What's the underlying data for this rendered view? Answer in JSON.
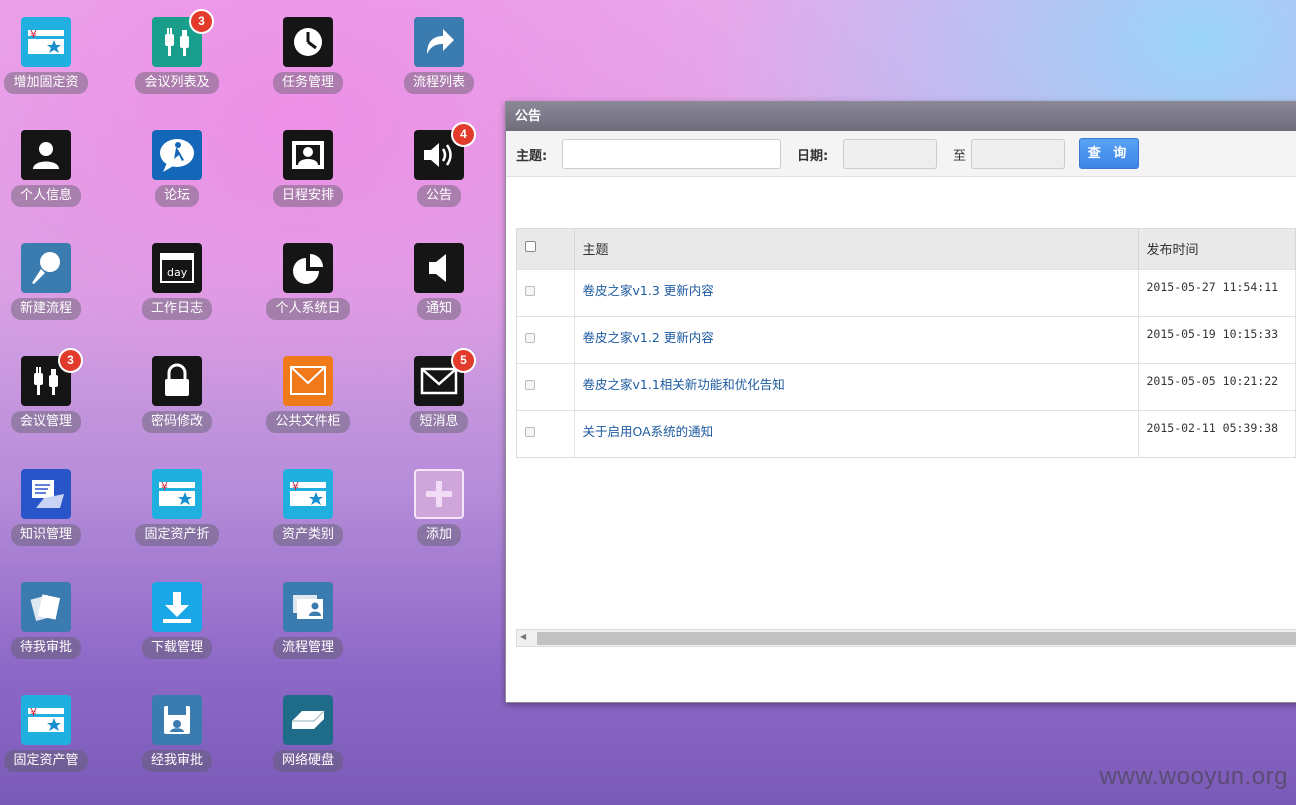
{
  "desktop": {
    "icons": [
      {
        "label": "增加固定资",
        "icon": "asset-card-icon",
        "color": "#1fb0e0"
      },
      {
        "label": "会议列表及",
        "icon": "plug-icon",
        "color": "#1a9e8c",
        "badge": "3"
      },
      {
        "label": "任务管理",
        "icon": "clock-icon",
        "color": "#151515"
      },
      {
        "label": "流程列表",
        "icon": "share-arrow-icon",
        "color": "#3a7bb0"
      },
      {
        "label": "个人信息",
        "icon": "person-icon",
        "color": "#151515"
      },
      {
        "label": "论坛",
        "icon": "forum-bubble-icon",
        "color": "#1466b8"
      },
      {
        "label": "日程安排",
        "icon": "schedule-icon",
        "color": "#151515"
      },
      {
        "label": "公告",
        "icon": "speaker-icon",
        "color": "#151515",
        "badge": "4"
      },
      {
        "label": "新建流程",
        "icon": "pushpin-icon",
        "color": "#3a7bb0"
      },
      {
        "label": "工作日志",
        "icon": "calendar-day-icon",
        "color": "#151515"
      },
      {
        "label": "个人系统日",
        "icon": "pie-chart-icon",
        "color": "#151515"
      },
      {
        "label": "通知",
        "icon": "volume-icon",
        "color": "#151515"
      },
      {
        "label": "会议管理",
        "icon": "plug-icon",
        "color": "#151515",
        "badge": "3"
      },
      {
        "label": "密码修改",
        "icon": "lock-icon",
        "color": "#151515"
      },
      {
        "label": "公共文件柜",
        "icon": "mail-open-icon",
        "color": "#f07a1a"
      },
      {
        "label": "短消息",
        "icon": "envelope-icon",
        "color": "#151515",
        "badge": "5"
      },
      {
        "label": "知识管理",
        "icon": "laptop-icon",
        "color": "#2a55c8"
      },
      {
        "label": "固定资产折",
        "icon": "asset-card-icon",
        "color": "#1fb0e0"
      },
      {
        "label": "资产类别",
        "icon": "asset-card-icon",
        "color": "#1fb0e0"
      },
      {
        "label": "添加",
        "icon": "plus-icon",
        "color": "#cfa6dc"
      },
      {
        "label": "待我审批",
        "icon": "pages-icon",
        "color": "#3a7bb0"
      },
      {
        "label": "下载管理",
        "icon": "download-icon",
        "color": "#1aa7e8"
      },
      {
        "label": "流程管理",
        "icon": "cards-icon",
        "color": "#3a7bb0"
      },
      {
        "label": "固定资产管",
        "icon": "asset-card-icon",
        "color": "#1fb0e0"
      },
      {
        "label": "经我审批",
        "icon": "floppy-icon",
        "color": "#3a7bb0"
      },
      {
        "label": "网络硬盘",
        "icon": "harddisk-icon",
        "color": "#1f6c8a"
      }
    ]
  },
  "window": {
    "title": "公告",
    "search": {
      "subject_label": "主题:",
      "subject_value": "",
      "date_label": "日期:",
      "date_from": "",
      "to_label": "至",
      "date_to": "",
      "query_button": "查 询"
    },
    "table": {
      "columns": [
        "主题",
        "发布时间",
        "发"
      ],
      "rows": [
        {
          "subject": "卷皮之家v1.3 更新内容",
          "time": "2015-05-27 11:54:11"
        },
        {
          "subject": "卷皮之家v1.2 更新内容",
          "time": "2015-05-19 10:15:33"
        },
        {
          "subject": "卷皮之家v1.1相关新功能和优化告知",
          "time": "2015-05-05 10:21:22"
        },
        {
          "subject": "关于启用OA系统的通知",
          "time": "2015-02-11 05:39:38"
        }
      ]
    }
  },
  "watermark": "www.wooyun.org"
}
